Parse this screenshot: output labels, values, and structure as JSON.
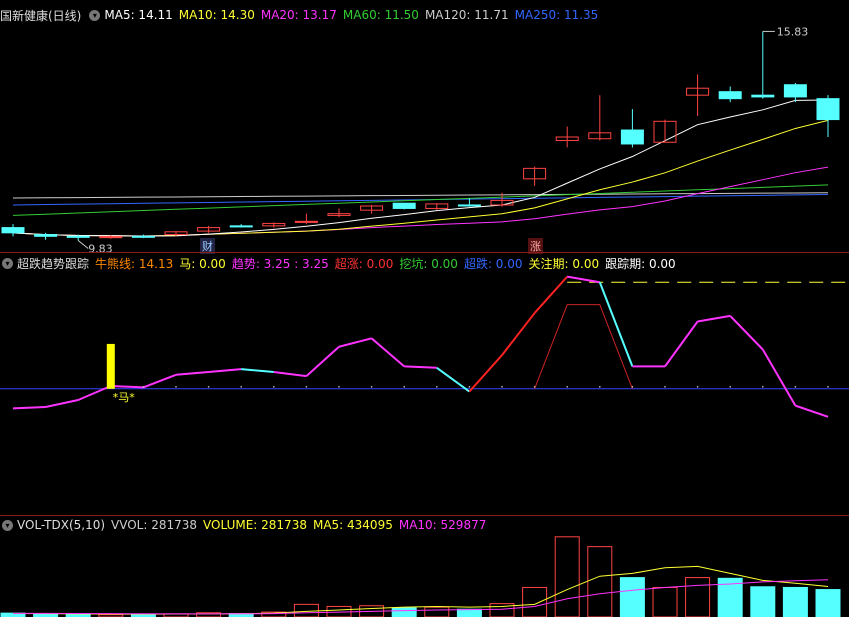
{
  "main": {
    "title": "国新健康(日线)",
    "ma": [
      {
        "label": "MA5:",
        "value": "14.11",
        "color": "#ffffff"
      },
      {
        "label": "MA10:",
        "value": "14.30",
        "color": "#ffff33"
      },
      {
        "label": "MA20:",
        "value": "13.17",
        "color": "#ff33ff"
      },
      {
        "label": "MA60:",
        "value": "11.50",
        "color": "#33cc33"
      },
      {
        "label": "MA120:",
        "value": "11.71",
        "color": "#cccccc"
      },
      {
        "label": "MA250:",
        "value": "11.35",
        "color": "#3366ff"
      }
    ],
    "high_label": "15.83",
    "low_label": "9.83",
    "markers": {
      "cai": "财",
      "zhang": "涨"
    }
  },
  "indicator": {
    "title": "超跌趋势跟踪",
    "fields": [
      {
        "label": "牛熊线:",
        "value": "14.13",
        "color": "#ff8800"
      },
      {
        "label": "马:",
        "value": "0.00",
        "color": "#ffff33"
      },
      {
        "label": "趋势:",
        "value": "3.25 : 3.25",
        "color": "#ff33ff"
      },
      {
        "label": "超涨:",
        "value": "0.00",
        "color": "#ff3333"
      },
      {
        "label": "挖坑:",
        "value": "0.00",
        "color": "#33cc33"
      },
      {
        "label": "超跌:",
        "value": "0.00",
        "color": "#3366ff"
      },
      {
        "label": "关注期:",
        "value": "0.00",
        "color": "#ffff33"
      },
      {
        "label": "跟踪期:",
        "value": "0.00",
        "color": "#ffffff"
      }
    ],
    "horse_label": "*马*"
  },
  "volume": {
    "title": "VOL-TDX(5,10)",
    "fields": [
      {
        "label": "VVOL:",
        "value": "281738",
        "color": "#cccccc"
      },
      {
        "label": "VOLUME:",
        "value": "281738",
        "color": "#ffff33"
      },
      {
        "label": "MA5:",
        "value": "434095",
        "color": "#ffff33"
      },
      {
        "label": "MA10:",
        "value": "529877",
        "color": "#ff33ff"
      }
    ]
  },
  "colors": {
    "up": "#ff4444",
    "down": "#55ffff",
    "ma5": "#ffffff",
    "ma10": "#ffff33",
    "ma20": "#ff33ff",
    "ma60": "#33cc33",
    "ma120": "#cccccc",
    "ma250": "#3366ff"
  },
  "candles": [
    {
      "o": 10.2,
      "h": 10.3,
      "l": 9.95,
      "c": 10.05
    },
    {
      "o": 10.0,
      "h": 10.05,
      "l": 9.85,
      "c": 9.95
    },
    {
      "o": 9.95,
      "h": 10.0,
      "l": 9.83,
      "c": 9.92
    },
    {
      "o": 9.92,
      "h": 9.98,
      "l": 9.88,
      "c": 9.94
    },
    {
      "o": 9.95,
      "h": 10.0,
      "l": 9.9,
      "c": 9.93
    },
    {
      "o": 10.0,
      "h": 10.1,
      "l": 9.95,
      "c": 10.08
    },
    {
      "o": 10.1,
      "h": 10.25,
      "l": 10.05,
      "c": 10.2
    },
    {
      "o": 10.25,
      "h": 10.3,
      "l": 10.2,
      "c": 10.22
    },
    {
      "o": 10.25,
      "h": 10.35,
      "l": 10.2,
      "c": 10.32
    },
    {
      "o": 10.35,
      "h": 10.6,
      "l": 10.3,
      "c": 10.38
    },
    {
      "o": 10.55,
      "h": 10.75,
      "l": 10.5,
      "c": 10.6
    },
    {
      "o": 10.7,
      "h": 10.85,
      "l": 10.6,
      "c": 10.82
    },
    {
      "o": 10.9,
      "h": 10.9,
      "l": 10.72,
      "c": 10.75
    },
    {
      "o": 10.75,
      "h": 10.9,
      "l": 10.7,
      "c": 10.88
    },
    {
      "o": 10.85,
      "h": 11.05,
      "l": 10.8,
      "c": 10.82
    },
    {
      "o": 10.85,
      "h": 11.2,
      "l": 10.8,
      "c": 10.98
    },
    {
      "o": 11.6,
      "h": 11.95,
      "l": 11.4,
      "c": 11.9
    },
    {
      "o": 12.7,
      "h": 13.1,
      "l": 12.5,
      "c": 12.8
    },
    {
      "o": 12.75,
      "h": 14.0,
      "l": 12.7,
      "c": 12.92
    },
    {
      "o": 13.0,
      "h": 13.6,
      "l": 12.5,
      "c": 12.6
    },
    {
      "o": 12.65,
      "h": 13.3,
      "l": 12.65,
      "c": 13.25
    },
    {
      "o": 14.0,
      "h": 14.6,
      "l": 13.4,
      "c": 14.2
    },
    {
      "o": 14.1,
      "h": 14.25,
      "l": 13.8,
      "c": 13.9
    },
    {
      "o": 14.0,
      "h": 15.83,
      "l": 13.9,
      "c": 13.95
    },
    {
      "o": 14.3,
      "h": 14.35,
      "l": 13.8,
      "c": 13.95
    },
    {
      "o": 13.9,
      "h": 14.0,
      "l": 12.8,
      "c": 13.3
    }
  ],
  "volumes": [
    55000,
    40000,
    38000,
    33000,
    35000,
    45000,
    60000,
    50000,
    70000,
    180000,
    150000,
    160000,
    130000,
    140000,
    110000,
    190000,
    420000,
    1140000,
    1000000,
    560000,
    420000,
    560000,
    550000,
    430000,
    420000,
    390000
  ],
  "vol_ma5": [
    50000,
    48000,
    45000,
    42000,
    40000,
    42000,
    44000,
    46000,
    55000,
    80000,
    100000,
    120000,
    140000,
    150000,
    140000,
    150000,
    180000,
    390000,
    580000,
    620000,
    700000,
    720000,
    620000,
    520000,
    480000,
    434095
  ],
  "vol_ma10": [
    52000,
    51000,
    50000,
    48000,
    46000,
    45000,
    45000,
    46000,
    48000,
    60000,
    70000,
    80000,
    90000,
    100000,
    105000,
    110000,
    150000,
    260000,
    330000,
    380000,
    420000,
    450000,
    470000,
    500000,
    515000,
    529877
  ],
  "trend": [
    -0.7,
    -0.65,
    -0.4,
    0.1,
    0.05,
    0.5,
    0.6,
    0.7,
    0.6,
    0.45,
    1.5,
    1.8,
    0.8,
    0.75,
    -0.1,
    1.2,
    2.7,
    4.0,
    3.8,
    0.8,
    0.8,
    2.4,
    2.6,
    1.4,
    -0.6,
    -1.0
  ],
  "boll": [
    0,
    0,
    0,
    0,
    0,
    0,
    0,
    0,
    0,
    0,
    0,
    0,
    0,
    0,
    0,
    0,
    0,
    0,
    2.5,
    0,
    0,
    0,
    0,
    0,
    0,
    0
  ]
}
